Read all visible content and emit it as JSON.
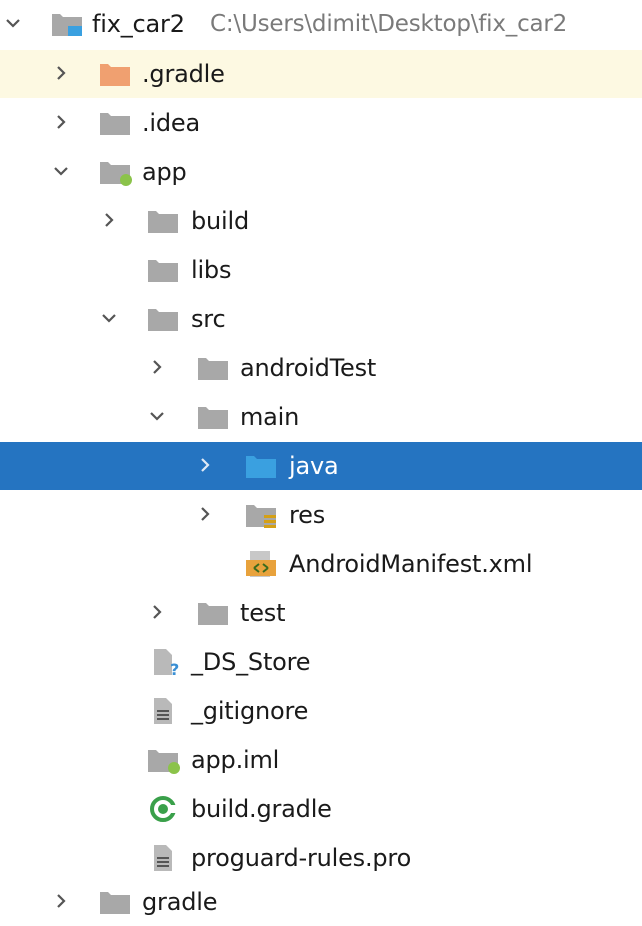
{
  "project_tree": {
    "root": {
      "name": "fix_car2",
      "path": "C:\\Users\\dimit\\Desktop\\fix_car2"
    },
    "items": [
      {
        "label": ".gradle"
      },
      {
        "label": ".idea"
      },
      {
        "label": "app"
      },
      {
        "label": "build"
      },
      {
        "label": "libs"
      },
      {
        "label": "src"
      },
      {
        "label": "androidTest"
      },
      {
        "label": "main"
      },
      {
        "label": "java"
      },
      {
        "label": "res"
      },
      {
        "label": "AndroidManifest.xml"
      },
      {
        "label": "test"
      },
      {
        "label": "_DS_Store"
      },
      {
        "label": "_gitignore"
      },
      {
        "label": "app.iml"
      },
      {
        "label": "build.gradle"
      },
      {
        "label": "proguard-rules.pro"
      },
      {
        "label": "gradle"
      }
    ]
  },
  "colors": {
    "selection": "#2574c1",
    "hover": "#fdf9e2",
    "folder": "#a8a8a8",
    "excluded_folder": "#f0a070",
    "source_folder": "#3aa0e0",
    "module_dot": "#8bc34a"
  }
}
